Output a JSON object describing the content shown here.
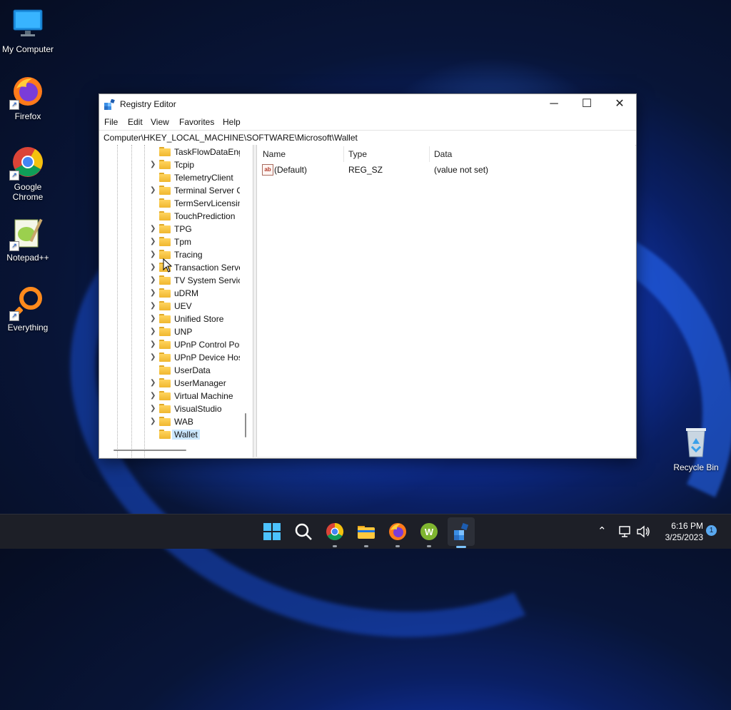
{
  "desktop": {
    "icons": [
      {
        "label": "My Computer",
        "icon": "monitor-icon"
      },
      {
        "label": "Firefox",
        "icon": "firefox-icon"
      },
      {
        "label": "Google Chrome",
        "icon": "chrome-icon"
      },
      {
        "label": "Notepad++",
        "icon": "notepadpp-icon"
      },
      {
        "label": "Everything",
        "icon": "everything-icon"
      },
      {
        "label": "Recycle Bin",
        "icon": "recycle-bin-icon"
      }
    ]
  },
  "window": {
    "title": "Registry Editor",
    "controls": {
      "minimize": "─",
      "maximize": "☐",
      "close": "✕"
    },
    "menu": [
      "File",
      "Edit",
      "View",
      "Favorites",
      "Help"
    ],
    "address": "Computer\\HKEY_LOCAL_MACHINE\\SOFTWARE\\Microsoft\\Wallet",
    "tree": [
      {
        "label": "TaskFlowDataEng",
        "arrow": false
      },
      {
        "label": "Tcpip",
        "arrow": true
      },
      {
        "label": "TelemetryClient",
        "arrow": false
      },
      {
        "label": "Terminal Server C",
        "arrow": true
      },
      {
        "label": "TermServLicensin",
        "arrow": false
      },
      {
        "label": "TouchPrediction",
        "arrow": false
      },
      {
        "label": "TPG",
        "arrow": true
      },
      {
        "label": "Tpm",
        "arrow": true
      },
      {
        "label": "Tracing",
        "arrow": true
      },
      {
        "label": "Transaction Serve",
        "arrow": true
      },
      {
        "label": "TV System Service",
        "arrow": true
      },
      {
        "label": "uDRM",
        "arrow": true
      },
      {
        "label": "UEV",
        "arrow": true
      },
      {
        "label": "Unified Store",
        "arrow": true
      },
      {
        "label": "UNP",
        "arrow": true
      },
      {
        "label": "UPnP Control Poi",
        "arrow": true
      },
      {
        "label": "UPnP Device Hos",
        "arrow": true
      },
      {
        "label": "UserData",
        "arrow": false
      },
      {
        "label": "UserManager",
        "arrow": true
      },
      {
        "label": "Virtual Machine",
        "arrow": true
      },
      {
        "label": "VisualStudio",
        "arrow": true
      },
      {
        "label": "WAB",
        "arrow": true
      },
      {
        "label": "Wallet",
        "arrow": false,
        "selected": true
      }
    ],
    "list": {
      "columns": [
        "Name",
        "Type",
        "Data"
      ],
      "rows": [
        {
          "name": "(Default)",
          "type": "REG_SZ",
          "data": "(value not set)",
          "icon": "string-value-icon"
        }
      ]
    }
  },
  "taskbar": {
    "apps": [
      "start-icon",
      "search-icon",
      "chrome-icon",
      "file-explorer-icon",
      "firefox-icon",
      "wps-icon",
      "regedit-icon"
    ],
    "clock": {
      "time": "6:16 PM",
      "date": "3/25/2023"
    },
    "notification_count": "1",
    "accent": "#7cc4ff"
  }
}
